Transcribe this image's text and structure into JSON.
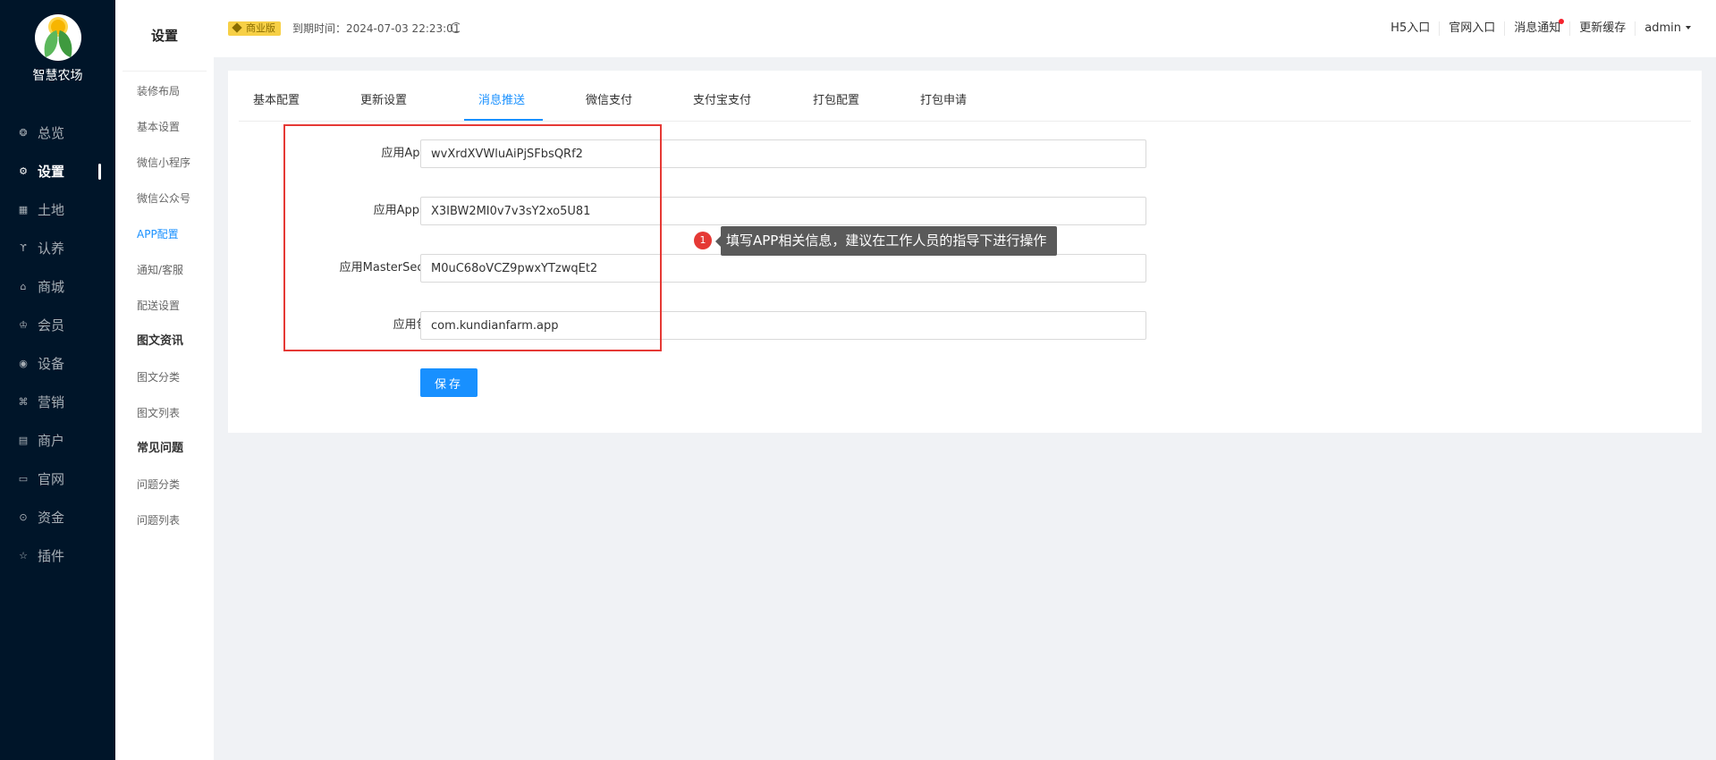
{
  "brand": {
    "name": "智慧农场"
  },
  "nav": {
    "items": [
      {
        "label": "总览",
        "icon": "dashboard-icon",
        "glyph": "❂"
      },
      {
        "label": "设置",
        "icon": "gear-icon",
        "glyph": "⚙"
      },
      {
        "label": "土地",
        "icon": "grid-icon",
        "glyph": "▦"
      },
      {
        "label": "认养",
        "icon": "animal-icon",
        "glyph": "ϒ"
      },
      {
        "label": "商城",
        "icon": "shop-icon",
        "glyph": "⌂"
      },
      {
        "label": "会员",
        "icon": "crown-icon",
        "glyph": "♔"
      },
      {
        "label": "设备",
        "icon": "location-icon",
        "glyph": "◉"
      },
      {
        "label": "营销",
        "icon": "command-icon",
        "glyph": "⌘"
      },
      {
        "label": "商户",
        "icon": "store-icon",
        "glyph": "▤"
      },
      {
        "label": "官网",
        "icon": "browser-icon",
        "glyph": "▭"
      },
      {
        "label": "资金",
        "icon": "money-icon",
        "glyph": "⊙"
      },
      {
        "label": "插件",
        "icon": "star-icon",
        "glyph": "☆"
      }
    ]
  },
  "subnav": {
    "title": "设置",
    "items": [
      "装修布局",
      "基本设置",
      "微信小程序",
      "微信公众号",
      "APP配置",
      "通知/客服",
      "配送设置"
    ],
    "group1": {
      "title": "图文资讯",
      "items": [
        "图文分类",
        "图文列表"
      ]
    },
    "group2": {
      "title": "常见问题",
      "items": [
        "问题分类",
        "问题列表"
      ]
    }
  },
  "header": {
    "badge": "商业版",
    "expire": "到期时间：2024-07-03 22:23:01",
    "links": [
      "H5入口",
      "官网入口",
      "消息通知",
      "更新缓存"
    ],
    "user": "admin"
  },
  "tabs": [
    "基本配置",
    "更新设置",
    "消息推送",
    "微信支付",
    "支付宝支付",
    "打包配置",
    "打包申请"
  ],
  "form": {
    "appid": {
      "label": "应用AppID:",
      "value": "wvXrdXVWluAiPjSFbsQRf2"
    },
    "appkey": {
      "label": "应用AppKey:",
      "value": "X3IBW2MI0v7v3sY2xo5U81"
    },
    "secret": {
      "label": "应用MasterSecret:",
      "value": "M0uC68oVCZ9pwxYTzwqEt2"
    },
    "package": {
      "label": "应用包名:",
      "value": "com.kundianfarm.app"
    },
    "save": "保存"
  },
  "tip": {
    "number": "1",
    "text": "填写APP相关信息，建议在工作人员的指导下进行操作"
  },
  "colors": {
    "primary": "#1890ff",
    "nav_bg": "#001529",
    "highlight": "#e53935",
    "badge": "#f7d046"
  }
}
